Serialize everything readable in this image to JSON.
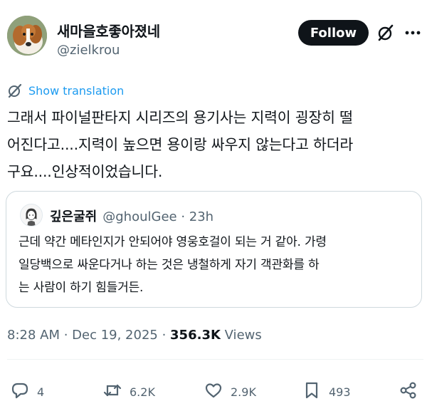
{
  "author": {
    "name": "새마을호좋아졌네",
    "handle": "@zielkrou"
  },
  "follow_label": "Follow",
  "icons": {
    "grok": "grok-icon",
    "more": "more-options-icon",
    "translate": "translate-globe-icon",
    "reply": "reply-icon",
    "repost": "repost-icon",
    "like": "heart-icon",
    "bookmark": "bookmark-icon",
    "share": "share-icon"
  },
  "translate_label": "Show translation",
  "tweet_text": "그래서 파이널판타지 시리즈의 용기사는 지력이 굉장히 떨\n어진다고....지력이 높으면 용이랑 싸우지 않는다고 하더라\n구요....인상적이었습니다.",
  "quote": {
    "name": "깊은굴쥐",
    "handle_time": "@ghoulGee · 23h",
    "text": "근데 약간 메타인지가 안되어야 영웅호걸이 되는 거 같아. 가령\n일당백으로 싸운다거나 하는 것은 냉철하게 자기 객관화를 하\n는 사람이 하기 힘들거든."
  },
  "meta": {
    "time_date": "8:28 AM · Dec 19, 2025 · ",
    "views_count": "356.3K",
    "views_label": " Views"
  },
  "stats": {
    "replies": "4",
    "reposts": "6.2K",
    "likes": "2.9K",
    "bookmarks": "493"
  },
  "colors": {
    "text": "#0f1419",
    "secondary": "#536471",
    "link": "#1d9bf0",
    "border": "#cfd9de"
  }
}
